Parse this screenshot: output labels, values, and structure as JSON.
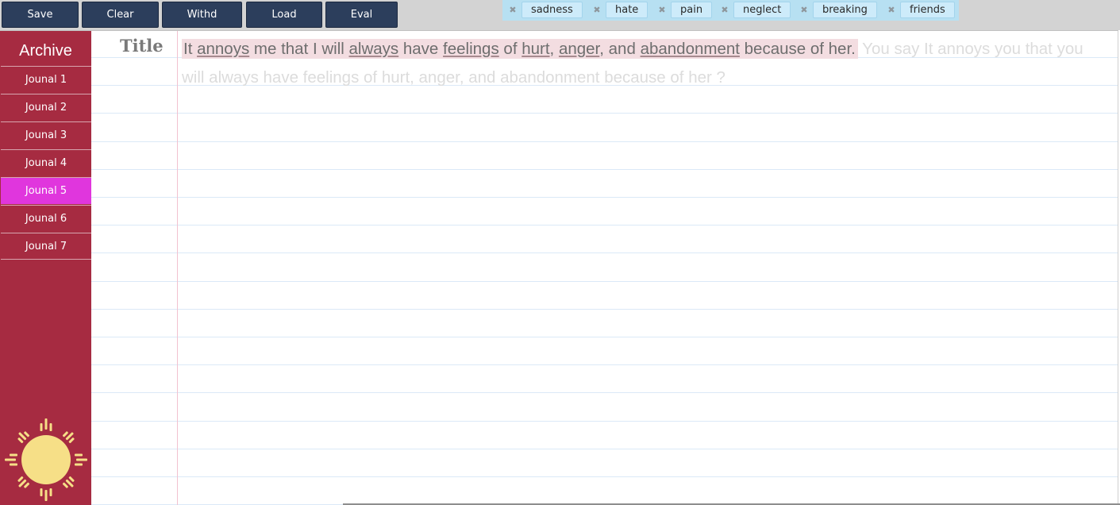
{
  "toolbar": {
    "buttons": [
      "Save",
      "Clear",
      "Withd",
      "Load",
      "Eval"
    ]
  },
  "tags": [
    "sadness",
    "hate",
    "pain",
    "neglect",
    "breaking",
    "friends"
  ],
  "sidebar": {
    "title": "Archive",
    "items": [
      "Jounal 1",
      "Jounal 2",
      "Jounal 3",
      "Jounal 4",
      "Jounal 5",
      "Jounal 6",
      "Jounal 7"
    ],
    "active_index": 4
  },
  "editor": {
    "title_label": "Title",
    "entry_parts": [
      "It ",
      "annoys",
      " me that I will ",
      "always",
      " have ",
      "feelings",
      " of ",
      "hurt",
      ", ",
      "anger",
      ", and ",
      "abandonment",
      " because of her."
    ],
    "ghost_text": " You say It annoys you that you will always have feelings of hurt, anger, and abandonment because of her ?"
  },
  "colors": {
    "sidebar_bg": "#a62b41",
    "active_item": "#e036dd",
    "button_bg": "#2c3e5c",
    "tag_bg": "#cdebfa",
    "highlight": "#f3dde1",
    "sun": "#f6df87"
  },
  "icons": {
    "tag_remove": "close-icon",
    "sidebar_logo": "sun-icon"
  }
}
